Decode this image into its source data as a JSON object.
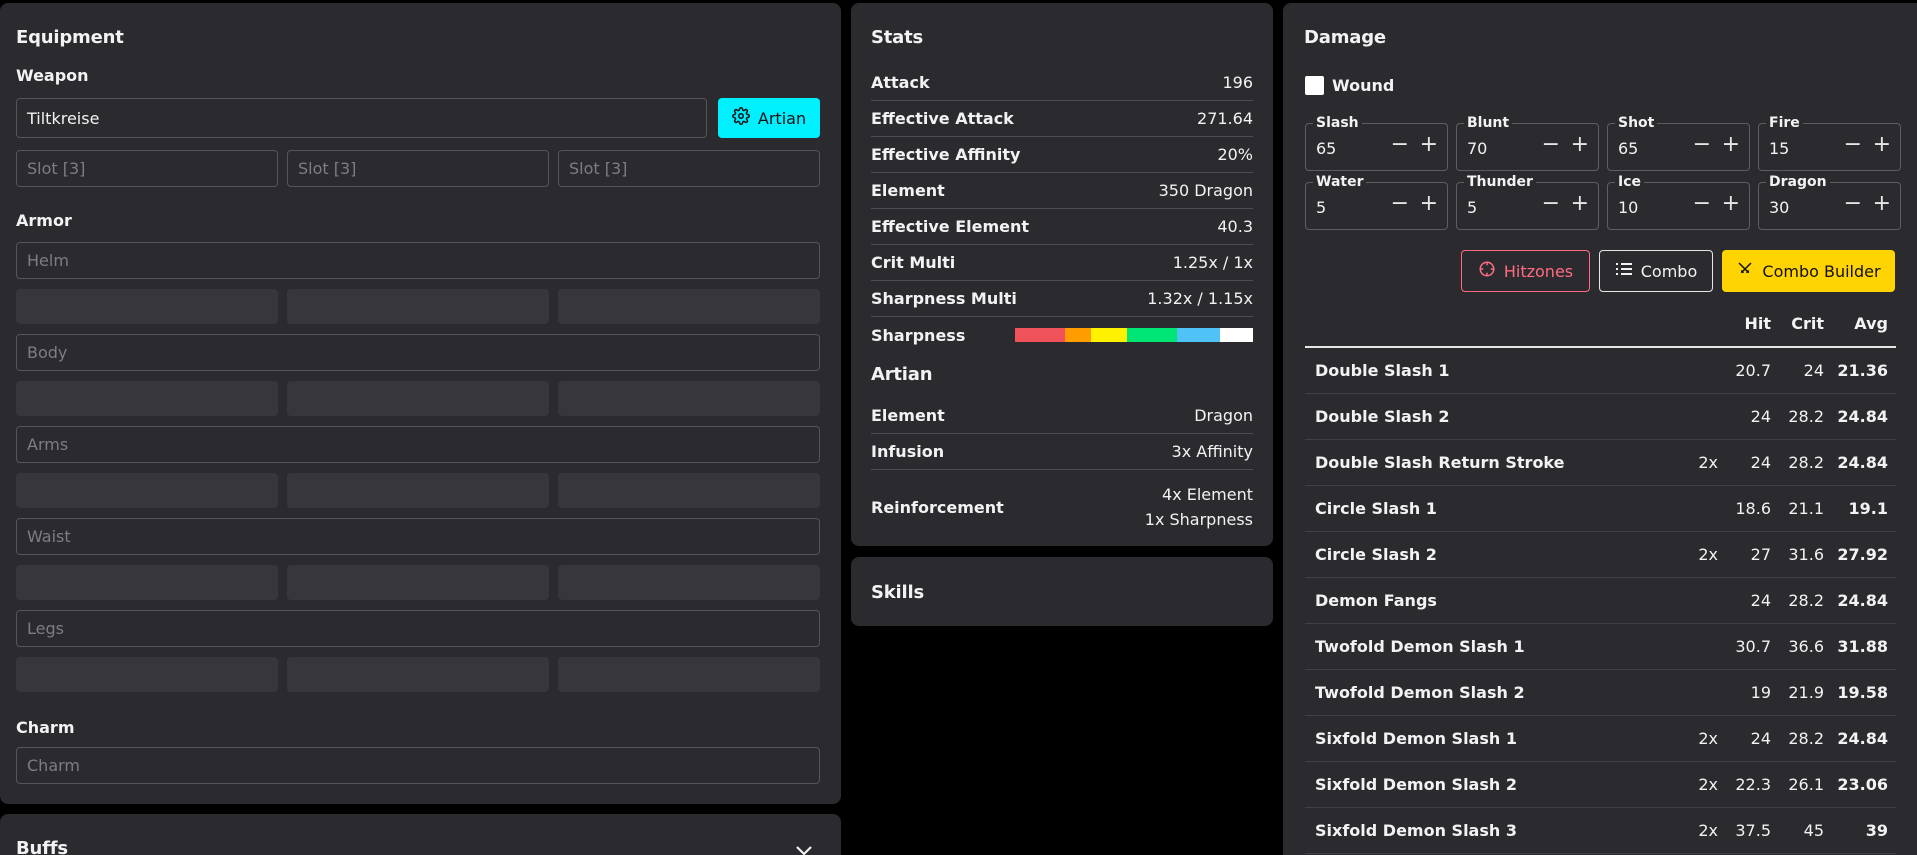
{
  "equipment": {
    "title": "Equipment",
    "weapon_label": "Weapon",
    "weapon_value": "Tiltkreise",
    "artian_button": "Artian",
    "weapon_slots": [
      "Slot [3]",
      "Slot [3]",
      "Slot [3]"
    ],
    "armor_label": "Armor",
    "armor_placeholders": [
      "Helm",
      "Body",
      "Arms",
      "Waist",
      "Legs"
    ],
    "charm_label": "Charm",
    "charm_placeholder": "Charm"
  },
  "buffs": {
    "title": "Buffs"
  },
  "stats": {
    "title": "Stats",
    "rows": [
      {
        "label": "Attack",
        "value": "196"
      },
      {
        "label": "Effective Attack",
        "value": "271.64"
      },
      {
        "label": "Effective Affinity",
        "value": "20%"
      },
      {
        "label": "Element",
        "value": "350 Dragon"
      },
      {
        "label": "Effective Element",
        "value": "40.3"
      },
      {
        "label": "Crit Multi",
        "value": "1.25x / 1x"
      },
      {
        "label": "Sharpness Multi",
        "value": "1.32x / 1.15x"
      }
    ],
    "sharpness_label": "Sharpness",
    "sharpness_segments": [
      {
        "color": "#f0525c",
        "fraction": 0.21
      },
      {
        "color": "#ff9d00",
        "fraction": 0.11
      },
      {
        "color": "#fff200",
        "fraction": 0.15
      },
      {
        "color": "#00e676",
        "fraction": 0.21
      },
      {
        "color": "#4fc3f7",
        "fraction": 0.18
      },
      {
        "color": "#ffffff",
        "fraction": 0.14
      }
    ],
    "artian_title": "Artian",
    "artian_rows": [
      {
        "label": "Element",
        "value": "Dragon"
      },
      {
        "label": "Infusion",
        "value": "3x Affinity"
      }
    ],
    "reinforcement_label": "Reinforcement",
    "reinforcement_values": [
      "4x Element",
      "1x Sharpness"
    ]
  },
  "skills": {
    "title": "Skills"
  },
  "damage": {
    "title": "Damage",
    "wound_label": "Wound",
    "wound_checked": false,
    "hitzone_fields": [
      {
        "label": "Slash",
        "value": "65"
      },
      {
        "label": "Blunt",
        "value": "70"
      },
      {
        "label": "Shot",
        "value": "65"
      },
      {
        "label": "Fire",
        "value": "15"
      },
      {
        "label": "Water",
        "value": "5"
      },
      {
        "label": "Thunder",
        "value": "5"
      },
      {
        "label": "Ice",
        "value": "10"
      },
      {
        "label": "Dragon",
        "value": "30"
      }
    ],
    "minus_glyph": "−",
    "plus_glyph": "+",
    "hitzones_button": "Hitzones",
    "combo_button": "Combo",
    "combo_builder_button": "Combo Builder",
    "columns": {
      "hit": "Hit",
      "crit": "Crit",
      "avg": "Avg"
    },
    "rows": [
      {
        "name": "Double Slash 1",
        "mult": "",
        "hit": "20.7",
        "crit": "24",
        "avg": "21.36"
      },
      {
        "name": "Double Slash 2",
        "mult": "",
        "hit": "24",
        "crit": "28.2",
        "avg": "24.84"
      },
      {
        "name": "Double Slash Return Stroke",
        "mult": "2x",
        "hit": "24",
        "crit": "28.2",
        "avg": "24.84"
      },
      {
        "name": "Circle Slash 1",
        "mult": "",
        "hit": "18.6",
        "crit": "21.1",
        "avg": "19.1"
      },
      {
        "name": "Circle Slash 2",
        "mult": "2x",
        "hit": "27",
        "crit": "31.6",
        "avg": "27.92"
      },
      {
        "name": "Demon Fangs",
        "mult": "",
        "hit": "24",
        "crit": "28.2",
        "avg": "24.84"
      },
      {
        "name": "Twofold Demon Slash 1",
        "mult": "",
        "hit": "30.7",
        "crit": "36.6",
        "avg": "31.88"
      },
      {
        "name": "Twofold Demon Slash 2",
        "mult": "",
        "hit": "19",
        "crit": "21.9",
        "avg": "19.58"
      },
      {
        "name": "Sixfold Demon Slash 1",
        "mult": "2x",
        "hit": "24",
        "crit": "28.2",
        "avg": "24.84"
      },
      {
        "name": "Sixfold Demon Slash 2",
        "mult": "2x",
        "hit": "22.3",
        "crit": "26.1",
        "avg": "23.06"
      },
      {
        "name": "Sixfold Demon Slash 3",
        "mult": "2x",
        "hit": "37.5",
        "crit": "45",
        "avg": "39"
      }
    ]
  },
  "colors": {
    "panel": "#2b2b2f",
    "artian_button": "#00f0ff",
    "hitzones_accent": "#ff6b81",
    "combo_builder": "#ffd400"
  }
}
